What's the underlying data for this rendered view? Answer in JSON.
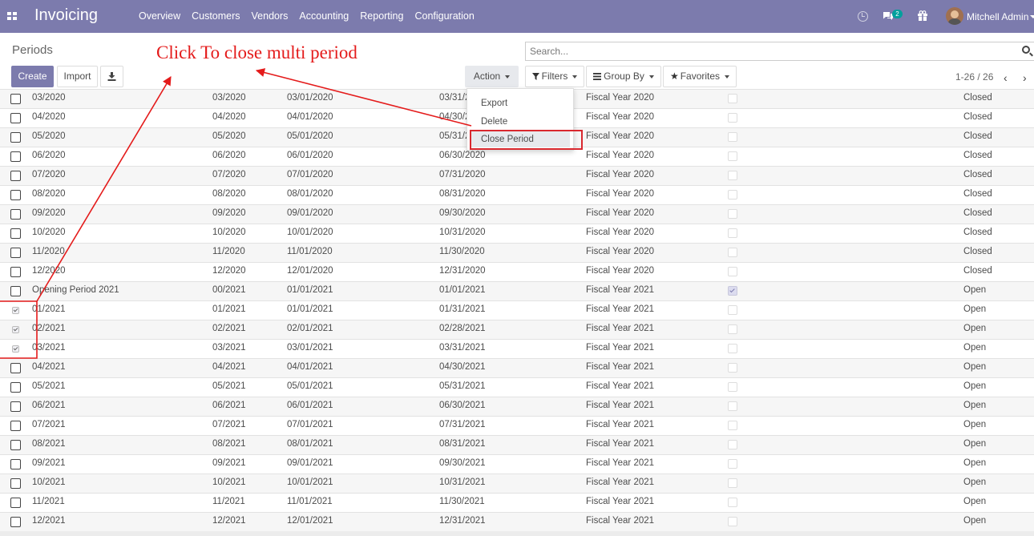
{
  "app": {
    "name": "Invoicing",
    "menu": [
      "Overview",
      "Customers",
      "Vendors",
      "Accounting",
      "Reporting",
      "Configuration"
    ],
    "chat_count": "2",
    "user_name": "Mitchell Admin",
    "brand_color": "#7c7bad"
  },
  "page": {
    "title": "Periods",
    "create_label": "Create",
    "import_label": "Import",
    "action_label": "Action",
    "filters_label": "Filters",
    "groupby_label": "Group By",
    "favorites_label": "Favorites",
    "search_placeholder": "Search...",
    "pager": "1-26 / 26",
    "pager_prev": "‹",
    "pager_next": "›"
  },
  "action_menu": {
    "items": [
      "Export",
      "Delete",
      "Close Period"
    ],
    "highlighted": "Close Period"
  },
  "annotation": {
    "text": "Click To close multi period",
    "color": "#e41b1b"
  },
  "rows": [
    {
      "name": "03/2020",
      "code": "03/2020",
      "start": "03/01/2020",
      "end": "03/31/2020",
      "fy": "Fiscal Year 2020",
      "special": false,
      "state": "Closed",
      "selected": false
    },
    {
      "name": "04/2020",
      "code": "04/2020",
      "start": "04/01/2020",
      "end": "04/30/2020",
      "fy": "Fiscal Year 2020",
      "special": false,
      "state": "Closed",
      "selected": false
    },
    {
      "name": "05/2020",
      "code": "05/2020",
      "start": "05/01/2020",
      "end": "05/31/2020",
      "fy": "Fiscal Year 2020",
      "special": false,
      "state": "Closed",
      "selected": false
    },
    {
      "name": "06/2020",
      "code": "06/2020",
      "start": "06/01/2020",
      "end": "06/30/2020",
      "fy": "Fiscal Year 2020",
      "special": false,
      "state": "Closed",
      "selected": false
    },
    {
      "name": "07/2020",
      "code": "07/2020",
      "start": "07/01/2020",
      "end": "07/31/2020",
      "fy": "Fiscal Year 2020",
      "special": false,
      "state": "Closed",
      "selected": false
    },
    {
      "name": "08/2020",
      "code": "08/2020",
      "start": "08/01/2020",
      "end": "08/31/2020",
      "fy": "Fiscal Year 2020",
      "special": false,
      "state": "Closed",
      "selected": false
    },
    {
      "name": "09/2020",
      "code": "09/2020",
      "start": "09/01/2020",
      "end": "09/30/2020",
      "fy": "Fiscal Year 2020",
      "special": false,
      "state": "Closed",
      "selected": false
    },
    {
      "name": "10/2020",
      "code": "10/2020",
      "start": "10/01/2020",
      "end": "10/31/2020",
      "fy": "Fiscal Year 2020",
      "special": false,
      "state": "Closed",
      "selected": false
    },
    {
      "name": "11/2020",
      "code": "11/2020",
      "start": "11/01/2020",
      "end": "11/30/2020",
      "fy": "Fiscal Year 2020",
      "special": false,
      "state": "Closed",
      "selected": false
    },
    {
      "name": "12/2020",
      "code": "12/2020",
      "start": "12/01/2020",
      "end": "12/31/2020",
      "fy": "Fiscal Year 2020",
      "special": false,
      "state": "Closed",
      "selected": false
    },
    {
      "name": "Opening Period 2021",
      "code": "00/2021",
      "start": "01/01/2021",
      "end": "01/01/2021",
      "fy": "Fiscal Year 2021",
      "special": true,
      "state": "Open",
      "selected": false
    },
    {
      "name": "01/2021",
      "code": "01/2021",
      "start": "01/01/2021",
      "end": "01/31/2021",
      "fy": "Fiscal Year 2021",
      "special": false,
      "state": "Open",
      "selected": true
    },
    {
      "name": "02/2021",
      "code": "02/2021",
      "start": "02/01/2021",
      "end": "02/28/2021",
      "fy": "Fiscal Year 2021",
      "special": false,
      "state": "Open",
      "selected": true
    },
    {
      "name": "03/2021",
      "code": "03/2021",
      "start": "03/01/2021",
      "end": "03/31/2021",
      "fy": "Fiscal Year 2021",
      "special": false,
      "state": "Open",
      "selected": true
    },
    {
      "name": "04/2021",
      "code": "04/2021",
      "start": "04/01/2021",
      "end": "04/30/2021",
      "fy": "Fiscal Year 2021",
      "special": false,
      "state": "Open",
      "selected": false
    },
    {
      "name": "05/2021",
      "code": "05/2021",
      "start": "05/01/2021",
      "end": "05/31/2021",
      "fy": "Fiscal Year 2021",
      "special": false,
      "state": "Open",
      "selected": false
    },
    {
      "name": "06/2021",
      "code": "06/2021",
      "start": "06/01/2021",
      "end": "06/30/2021",
      "fy": "Fiscal Year 2021",
      "special": false,
      "state": "Open",
      "selected": false
    },
    {
      "name": "07/2021",
      "code": "07/2021",
      "start": "07/01/2021",
      "end": "07/31/2021",
      "fy": "Fiscal Year 2021",
      "special": false,
      "state": "Open",
      "selected": false
    },
    {
      "name": "08/2021",
      "code": "08/2021",
      "start": "08/01/2021",
      "end": "08/31/2021",
      "fy": "Fiscal Year 2021",
      "special": false,
      "state": "Open",
      "selected": false
    },
    {
      "name": "09/2021",
      "code": "09/2021",
      "start": "09/01/2021",
      "end": "09/30/2021",
      "fy": "Fiscal Year 2021",
      "special": false,
      "state": "Open",
      "selected": false
    },
    {
      "name": "10/2021",
      "code": "10/2021",
      "start": "10/01/2021",
      "end": "10/31/2021",
      "fy": "Fiscal Year 2021",
      "special": false,
      "state": "Open",
      "selected": false
    },
    {
      "name": "11/2021",
      "code": "11/2021",
      "start": "11/01/2021",
      "end": "11/30/2021",
      "fy": "Fiscal Year 2021",
      "special": false,
      "state": "Open",
      "selected": false
    },
    {
      "name": "12/2021",
      "code": "12/2021",
      "start": "12/01/2021",
      "end": "12/31/2021",
      "fy": "Fiscal Year 2021",
      "special": false,
      "state": "Open",
      "selected": false
    }
  ]
}
